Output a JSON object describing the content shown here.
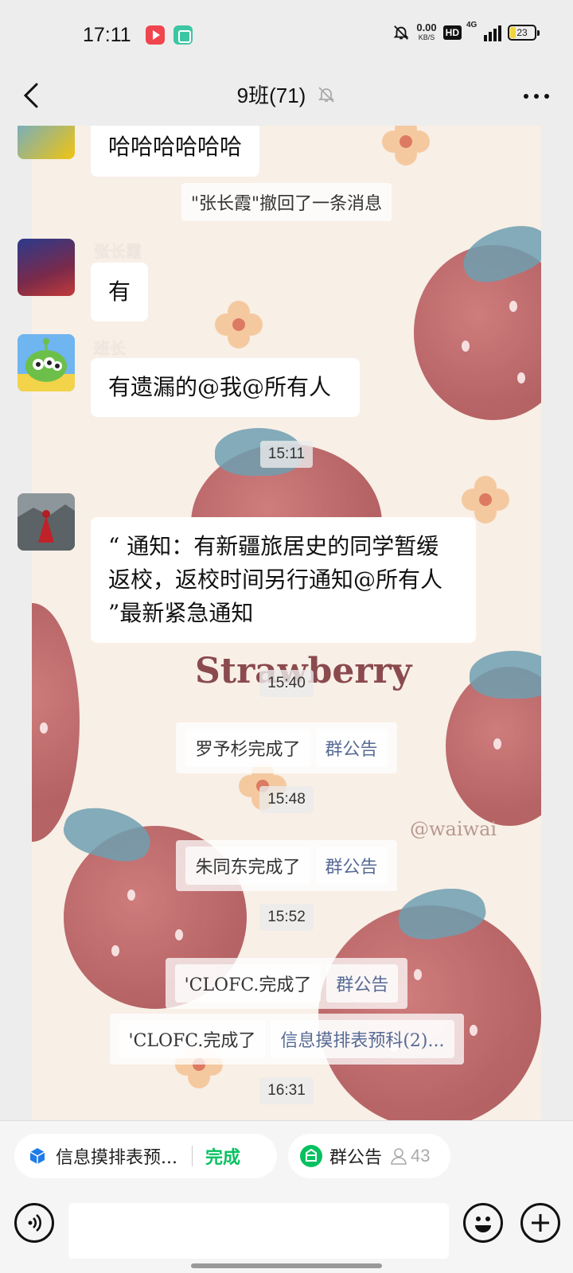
{
  "status": {
    "time": "17:11",
    "speed_value": "0.00",
    "speed_unit": "KB/S",
    "hd": "HD",
    "network": "4G",
    "battery": "23"
  },
  "header": {
    "title": "9班(71)"
  },
  "messages": {
    "m1_text": "哈哈哈哈哈哈",
    "recall_notice": "\"张长霞\"撤回了一条消息",
    "m2_sender": "张长霞",
    "m2_text": "有",
    "m3_sender": "班长",
    "m3_text": "有遗漏的@我@所有人",
    "t1": "15:11",
    "m4_sender": "",
    "m4_text": "“ 通知：有新疆旅居史的同学暂缓返校，返校时间另行通知@所有人 ”最新紧急通知",
    "t2": "15:40",
    "sys1_name": "罗予杉完成了",
    "sys1_link": "群公告",
    "t3": "15:48",
    "sys2_name": "朱同东完成了",
    "sys2_link": "群公告",
    "t4": "15:52",
    "sys3_name": "'CLOFC.完成了",
    "sys3_link": "群公告",
    "sys4_name": "'CLOFC.完成了",
    "sys4_link": "信息摸排表预科(2)...",
    "t5": "16:31"
  },
  "wallpaper": {
    "title": "Strawberry",
    "credit": "@waiwai"
  },
  "chips": {
    "chip1_label": "信息摸排表预...",
    "chip1_action": "完成",
    "chip2_label": "群公告",
    "chip2_count": "43"
  },
  "colors": {
    "accent_green": "#07c160",
    "link_blue": "#576b95"
  }
}
